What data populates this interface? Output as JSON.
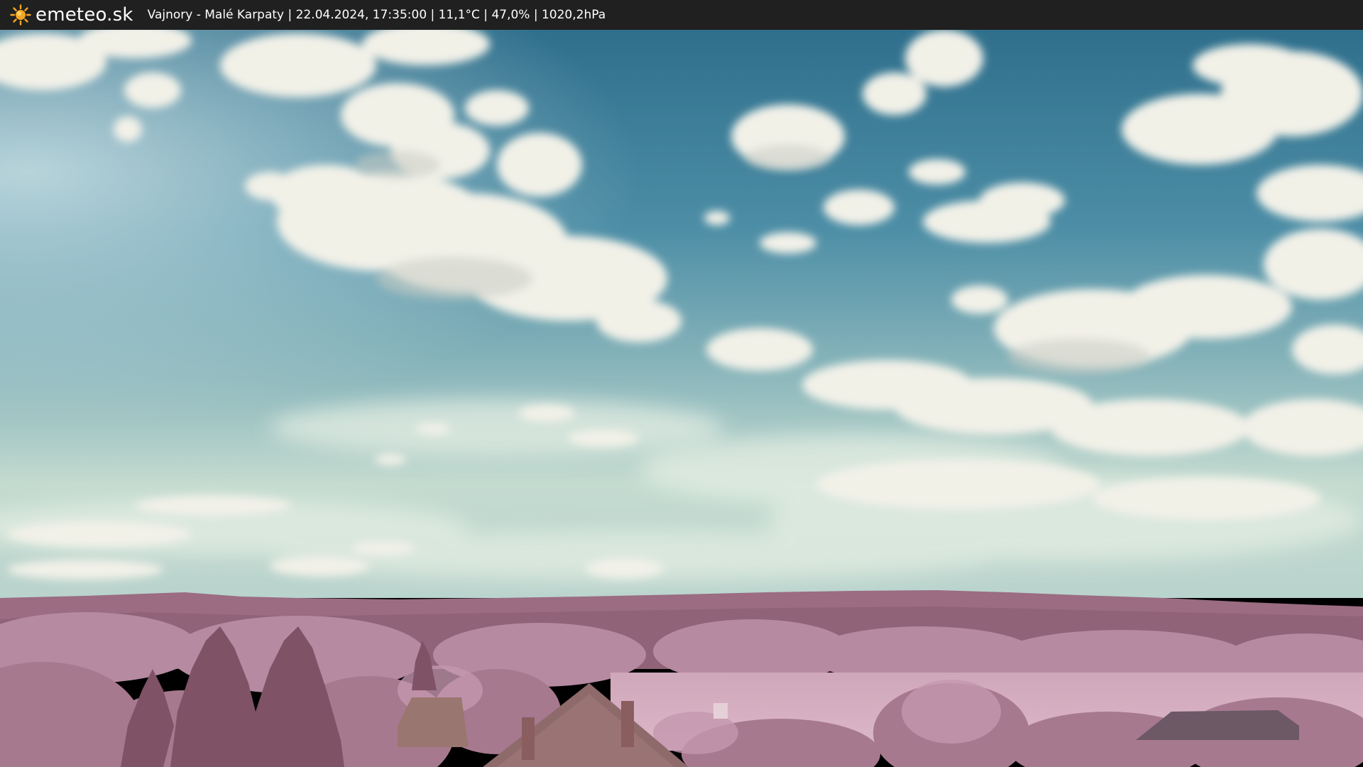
{
  "header": {
    "logo_text": "emeteo.sk",
    "logo_icon": "sun-icon",
    "caption": "Vajnory - Malé Karpaty | 22.04.2024, 17:35:00 | 11,1°C | 47,0% | 1020,2hPa"
  },
  "colors": {
    "bar_background": "#202020",
    "sun": "#f5a623",
    "sky_top": "#3f7f9b",
    "sky_horizon": "#c9ddd2",
    "hills": "#9a6b80",
    "foliage": "#b88aa2",
    "field": "#d4aec0"
  }
}
